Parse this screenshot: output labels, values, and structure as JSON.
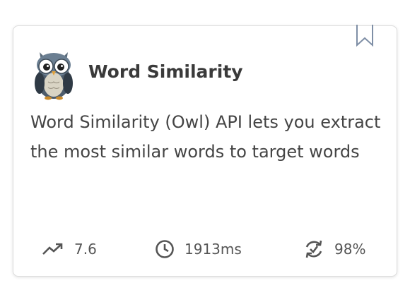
{
  "api_card": {
    "title": "Word Similarity",
    "description": "Word Similarity (Owl) API lets you extract the most similar words to target words",
    "logo_icon": "owl-logo-icon",
    "bookmark_icon": "bookmark-icon",
    "stats": {
      "popularity": {
        "icon": "trending-up-icon",
        "value": "7.6"
      },
      "latency": {
        "icon": "clock-icon",
        "value": "1913ms"
      },
      "success_rate": {
        "icon": "refresh-check-icon",
        "value": "98%"
      }
    }
  }
}
